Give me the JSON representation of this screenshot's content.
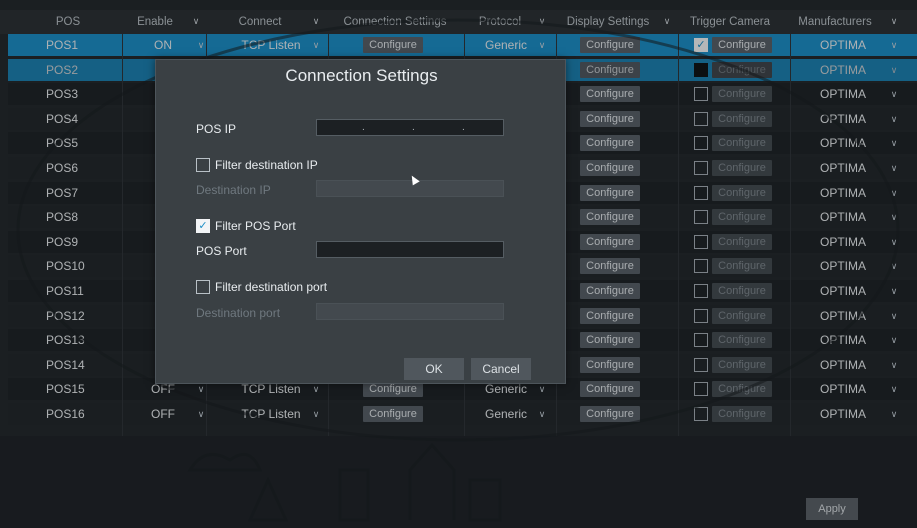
{
  "header": {
    "pos": "POS",
    "enable": "Enable",
    "connect": "Connect",
    "connection_settings": "Connection Settings",
    "protocol": "Protocol",
    "display_settings": "Display Settings",
    "trigger_camera": "Trigger Camera",
    "manufacturers": "Manufacturers"
  },
  "rows": [
    {
      "name": "POS1",
      "enable": "ON",
      "connect": "TCP Listen",
      "conn_btn": "Configure",
      "protocol": "Generic",
      "disp_btn": "Configure",
      "trig_checked": true,
      "trig_btn": "Configure",
      "manufacturer": "OPTIMA"
    },
    {
      "name": "POS2",
      "enable": "",
      "connect": "",
      "conn_btn": "",
      "protocol": "",
      "disp_btn": "Configure",
      "trig_checked": false,
      "trig_btn": "Configure",
      "manufacturer": "OPTIMA"
    },
    {
      "name": "POS3",
      "disp_btn": "Configure",
      "trig_btn": "Configure",
      "manufacturer": "OPTIMA"
    },
    {
      "name": "POS4",
      "disp_btn": "Configure",
      "trig_btn": "Configure",
      "manufacturer": "OPTIMA"
    },
    {
      "name": "POS5",
      "disp_btn": "Configure",
      "trig_btn": "Configure",
      "manufacturer": "OPTIMA"
    },
    {
      "name": "POS6",
      "disp_btn": "Configure",
      "trig_btn": "Configure",
      "manufacturer": "OPTIMA"
    },
    {
      "name": "POS7",
      "disp_btn": "Configure",
      "trig_btn": "Configure",
      "manufacturer": "OPTIMA"
    },
    {
      "name": "POS8",
      "disp_btn": "Configure",
      "trig_btn": "Configure",
      "manufacturer": "OPTIMA"
    },
    {
      "name": "POS9",
      "disp_btn": "Configure",
      "trig_btn": "Configure",
      "manufacturer": "OPTIMA"
    },
    {
      "name": "POS10",
      "disp_btn": "Configure",
      "trig_btn": "Configure",
      "manufacturer": "OPTIMA"
    },
    {
      "name": "POS11",
      "disp_btn": "Configure",
      "trig_btn": "Configure",
      "manufacturer": "OPTIMA"
    },
    {
      "name": "POS12",
      "disp_btn": "Configure",
      "trig_btn": "Configure",
      "manufacturer": "OPTIMA"
    },
    {
      "name": "POS13",
      "disp_btn": "Configure",
      "trig_btn": "Configure",
      "manufacturer": "OPTIMA"
    },
    {
      "name": "POS14",
      "disp_btn": "Configure",
      "trig_btn": "Configure",
      "manufacturer": "OPTIMA"
    },
    {
      "name": "POS15",
      "enable": "OFF",
      "connect": "TCP Listen",
      "conn_btn": "Configure",
      "protocol": "Generic",
      "disp_btn": "Configure",
      "trig_btn": "Configure",
      "manufacturer": "OPTIMA"
    },
    {
      "name": "POS16",
      "enable": "OFF",
      "connect": "TCP Listen",
      "conn_btn": "Configure",
      "protocol": "Generic",
      "disp_btn": "Configure",
      "trig_btn": "Configure",
      "manufacturer": "OPTIMA"
    }
  ],
  "dialog": {
    "title": "Connection Settings",
    "pos_ip_label": "POS IP",
    "pos_ip_value": ".   .   .",
    "filter_dest_ip_label": "Filter destination IP",
    "dest_ip_label": "Destination IP",
    "filter_pos_port_label": "Filter POS Port",
    "pos_port_label": "POS Port",
    "filter_dest_port_label": "Filter destination port",
    "dest_port_label": "Destination port",
    "ok": "OK",
    "cancel": "Cancel"
  },
  "footer": {
    "apply": "Apply"
  },
  "colors": {
    "selected_row": "#1c8ec6",
    "background": "#252a2e",
    "button": "#596169"
  }
}
